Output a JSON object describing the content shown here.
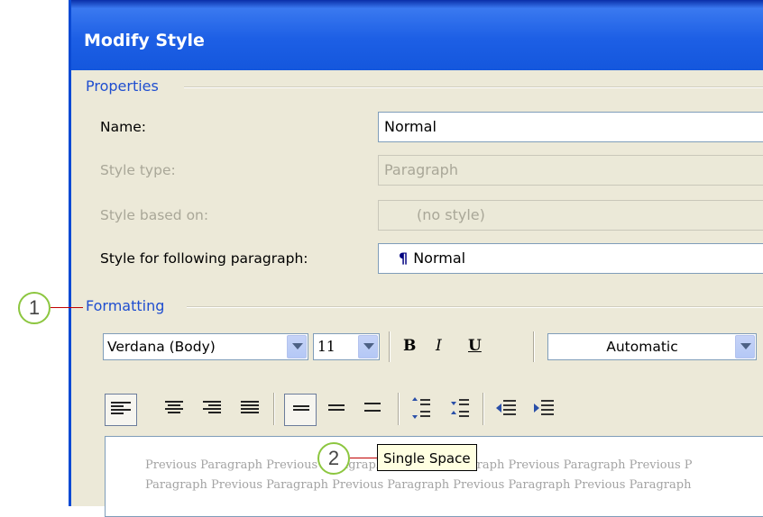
{
  "dialog": {
    "title": "Modify Style"
  },
  "properties": {
    "group_label": "Properties",
    "name_label": "Name:",
    "name_value": "Normal",
    "style_type_label": "Style type:",
    "style_type_value": "Paragraph",
    "based_on_label": "Style based on:",
    "based_on_value": "(no style)",
    "following_label": "Style for following paragraph:",
    "following_value": "Normal",
    "following_icon": "¶"
  },
  "formatting": {
    "group_label": "Formatting",
    "font": "Verdana (Body)",
    "size": "11",
    "bold": "B",
    "italic": "I",
    "underline": "U",
    "color": "Automatic"
  },
  "preview": {
    "line1": "Previous Paragraph Previous Paragraph Previous Paragraph Previous Paragraph Previous P",
    "line2": "Paragraph Previous Paragraph Previous Paragraph Previous Paragraph Previous Paragraph"
  },
  "tooltip": {
    "text": "Single Space"
  },
  "callouts": {
    "one": "1",
    "two": "2"
  }
}
